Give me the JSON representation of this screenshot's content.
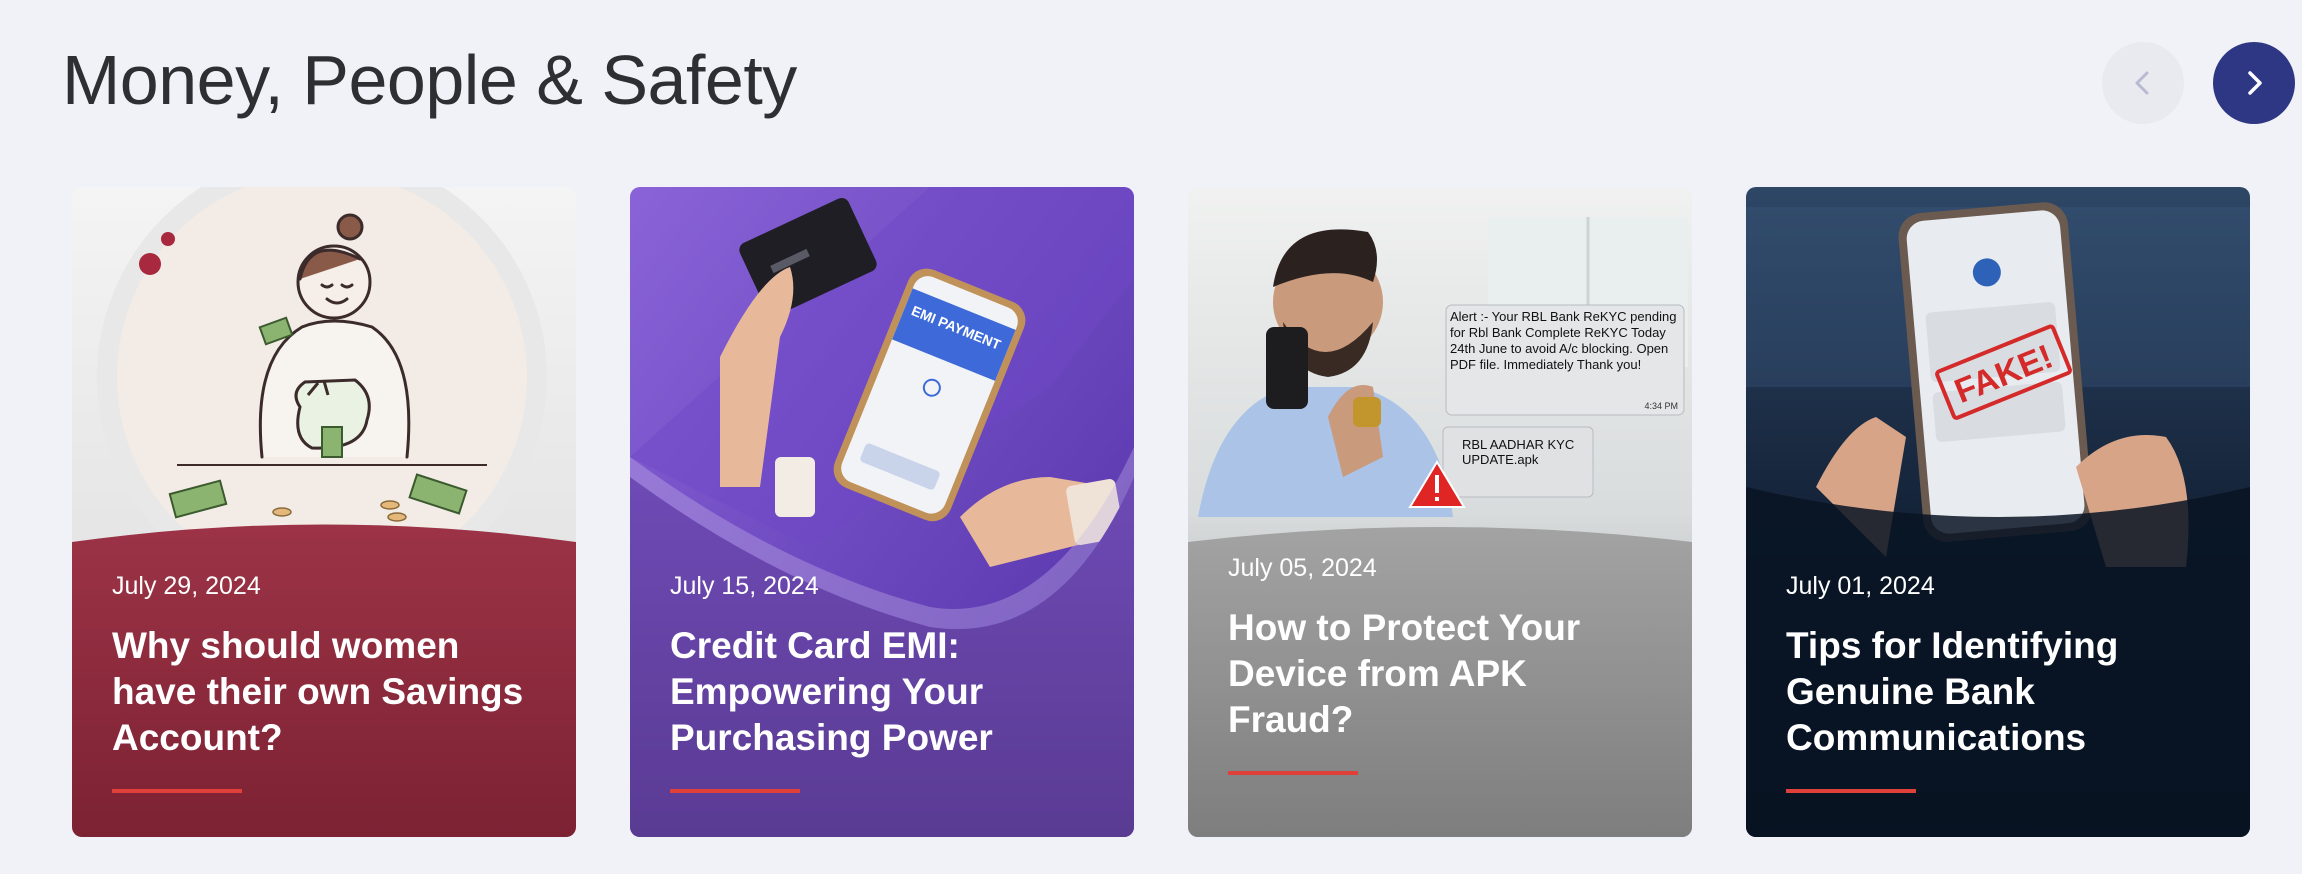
{
  "section": {
    "title": "Money, People & Safety"
  },
  "carousel": {
    "prev_icon": "chevron-left-icon",
    "next_icon": "chevron-right-icon",
    "prev_color": "#e9eaf0",
    "next_color": "#2d3784"
  },
  "cards": [
    {
      "date": "July 29, 2024",
      "title": "Why should women have their own Savings Account?",
      "theme": "#8e2a3f"
    },
    {
      "date": "July 15, 2024",
      "title": "Credit Card EMI: Empowering Your Purchasing Power",
      "theme": "#6a45a8",
      "phone_label": "EMI PAYMENT"
    },
    {
      "date": "July 05, 2024",
      "title": "How to Protect Your Device from APK Fraud?",
      "theme": "#8a8a8a",
      "sms_text": "Alert :- Your RBL Bank ReKYC pending for Rbl Bank Complete ReKYC Today 24th June to avoid A/c blocking. Open PDF file. Immediately Thank you!",
      "sms_time": "4:34 PM",
      "file_name": "RBL AADHAR KYC UPDATE.apk"
    },
    {
      "date": "July 01, 2024",
      "title": "Tips for Identifying Genuine Bank Communications",
      "theme": "#0b1626",
      "stamp": "FAKE!"
    }
  ],
  "accent_color": "#e0403a"
}
